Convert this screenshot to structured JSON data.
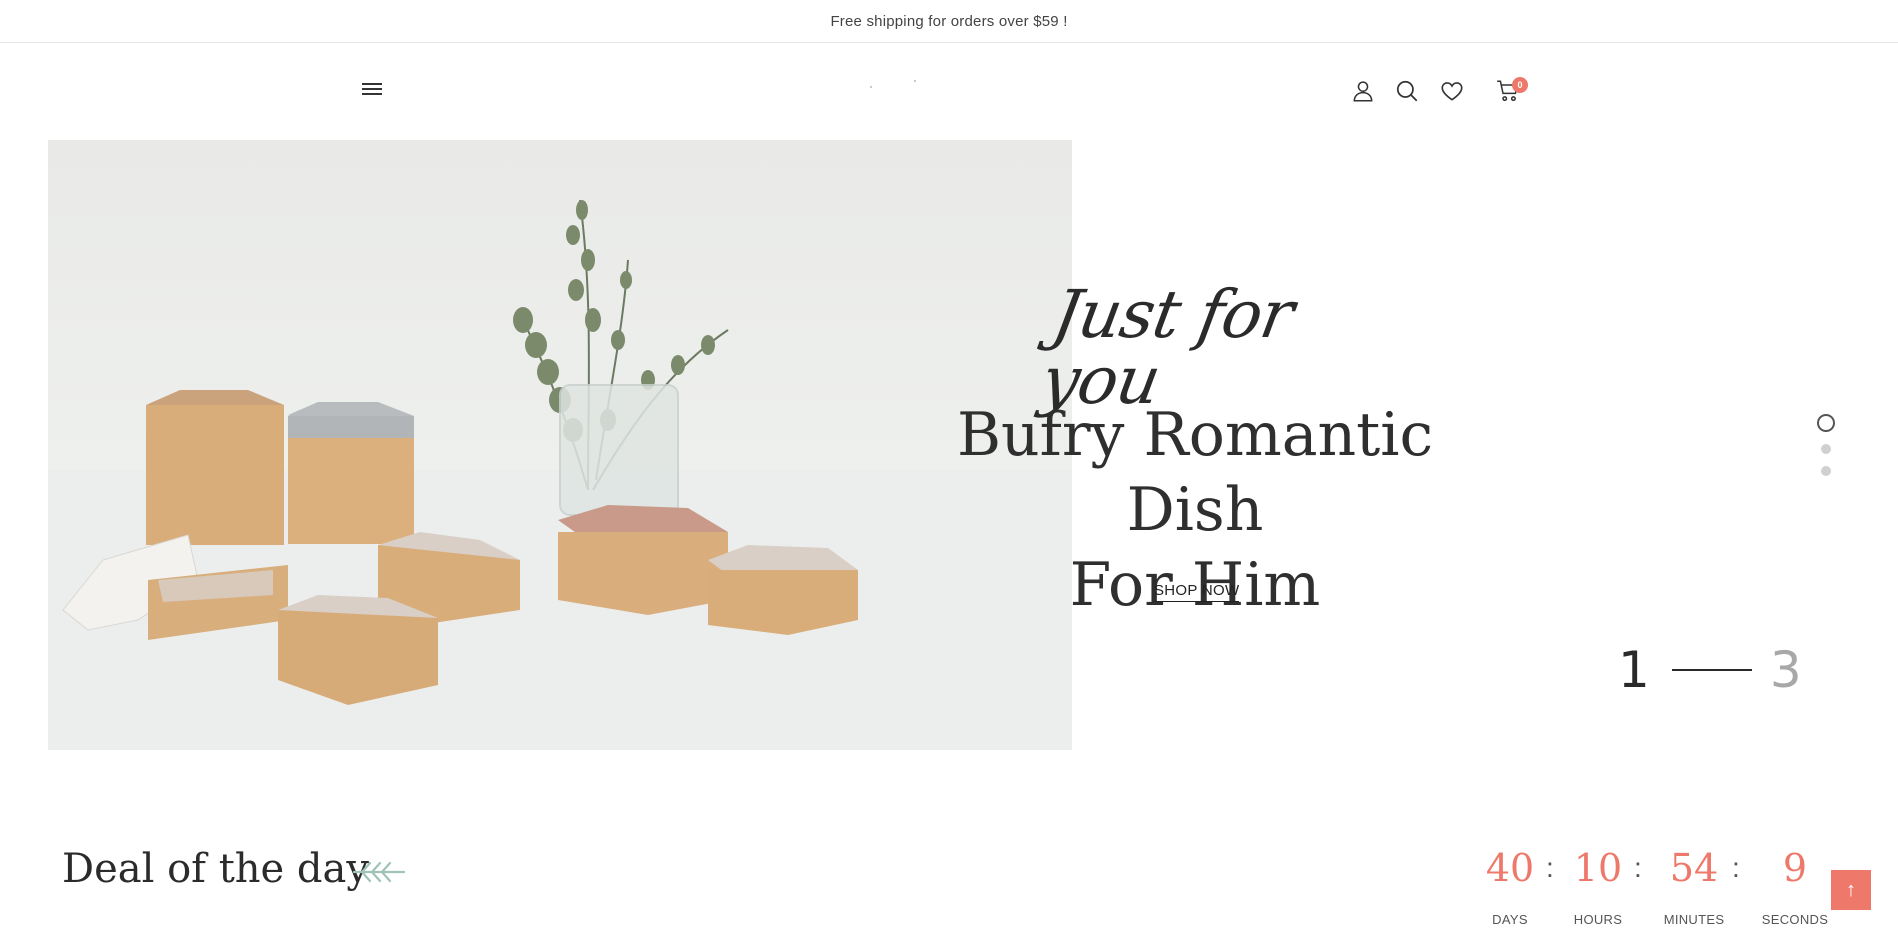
{
  "topbar": {
    "text": "Free shipping for orders over $59 !"
  },
  "header": {
    "menu_icon": "hamburger-menu-icon",
    "icons": [
      "user-icon",
      "search-icon",
      "heart-icon",
      "cart-icon"
    ],
    "cart_count": "0",
    "accent_color": "#ee7869"
  },
  "hero": {
    "script_title": "Just for you",
    "title_line1": "Bufry Romantic Dish",
    "title_line2": "For Him",
    "cta_label": "SHOP NOW",
    "slide_current": "1",
    "slide_total": "3",
    "slide_dots": 3,
    "active_dot": 1
  },
  "deal": {
    "title": "Deal of the day",
    "countdown": {
      "days": "40",
      "hours": "10",
      "minutes": "54",
      "seconds": "9",
      "days_label": "DAYS",
      "hours_label": "HOURS",
      "minutes_label": "MINUTES",
      "seconds_label": "SECONDS",
      "separator": ":"
    }
  },
  "scroll_top": {
    "icon": "arrow-up-icon",
    "glyph": "↑"
  }
}
